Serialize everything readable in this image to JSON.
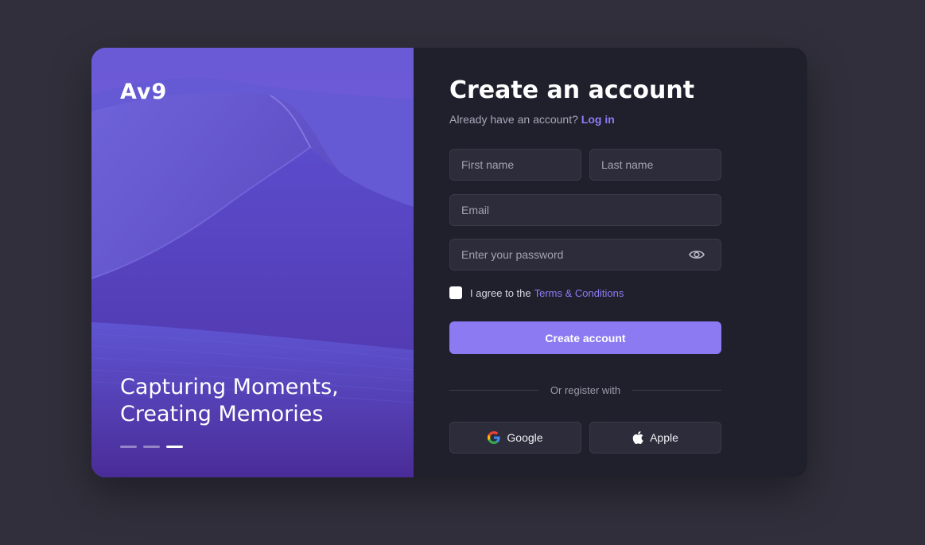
{
  "brand": {
    "logo": "Av9"
  },
  "hero": {
    "tagline_line1": "Capturing Moments,",
    "tagline_line2": "Creating Memories",
    "carousel": {
      "count": 3,
      "active_index": 2
    }
  },
  "form": {
    "title": "Create an account",
    "subtitle_text": "Already have an account?",
    "login_link": "Log in",
    "first_name_placeholder": "First name",
    "last_name_placeholder": "Last name",
    "email_placeholder": "Email",
    "password_placeholder": "Enter your password",
    "agree_text": "I agree to the",
    "terms_link": "Terms & Conditions",
    "submit_label": "Create account",
    "divider_text": "Or register with",
    "google_label": "Google",
    "apple_label": "Apple"
  },
  "icons": {
    "password_toggle": "eye-icon",
    "google": "google-icon",
    "apple": "apple-icon"
  },
  "colors": {
    "page_bg": "#302f3b",
    "card_bg": "#201f2c",
    "accent": "#8c7af3",
    "link": "#8d7cf6",
    "field_bg": "#2d2c3a"
  }
}
